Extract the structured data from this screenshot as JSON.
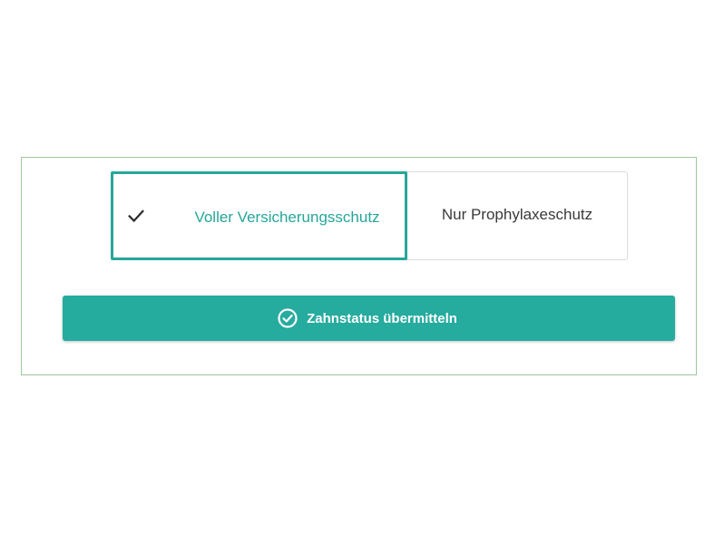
{
  "coverage_toggle": {
    "options": [
      {
        "label": "Voller Versicherungsschutz",
        "selected": true
      },
      {
        "label": "Nur Prophylaxeschutz",
        "selected": false
      }
    ]
  },
  "submit": {
    "label": "Zahnstatus übermitteln",
    "icon": "check-circle-icon"
  },
  "colors": {
    "accent": "#26a69a",
    "button_bg": "#26ab9f",
    "frame_border": "#9cc79c"
  }
}
